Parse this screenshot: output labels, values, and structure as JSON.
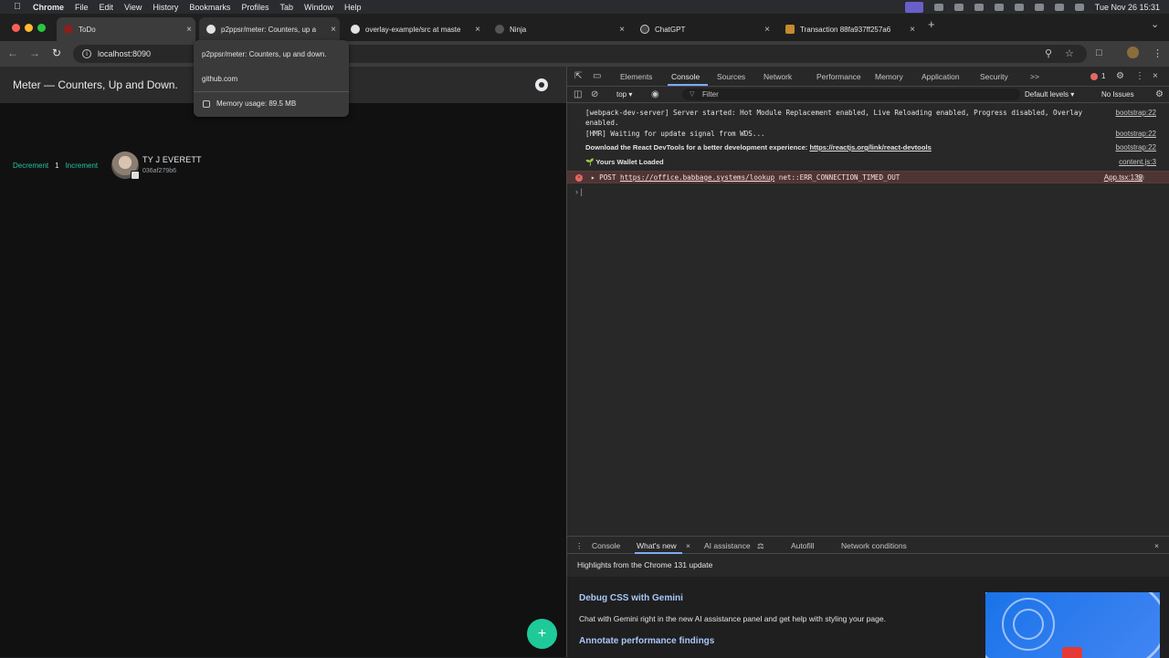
{
  "menubar": {
    "app": "Chrome",
    "menus": [
      "File",
      "Edit",
      "View",
      "History",
      "Bookmarks",
      "Profiles",
      "Tab",
      "Window",
      "Help"
    ],
    "clock": "Tue Nov 26  15:31"
  },
  "tabs": [
    {
      "label": "ToDo",
      "icon": "todo-favicon"
    },
    {
      "label": "p2ppsr/meter: Counters, up a",
      "icon": "github-icon"
    },
    {
      "label": "overlay-example/src at maste",
      "icon": "github-icon"
    },
    {
      "label": "Ninja",
      "icon": "ninja-favicon"
    },
    {
      "label": "ChatGPT",
      "icon": "chatgpt-icon"
    },
    {
      "label": "Transaction 88fa937ff257a6",
      "icon": "transaction-favicon"
    }
  ],
  "tooltip": {
    "title": "p2ppsr/meter: Counters, up and down.",
    "host": "github.com",
    "memory": "Memory usage: 89.5 MB"
  },
  "omnibox": {
    "url": "localhost:8090"
  },
  "app": {
    "title": "Meter — Counters, Up and Down.",
    "decrement": "Decrement",
    "count": "1",
    "increment": "Increment",
    "user_name": "TY J EVERETT",
    "user_id": "036af279b6",
    "fab": "+"
  },
  "devtools": {
    "tabs": [
      "Elements",
      "Console",
      "Sources",
      "Network",
      "Performance",
      "Memory",
      "Application",
      "Security"
    ],
    "more": ">>",
    "error_count": "1",
    "context": "top ▾",
    "filter_placeholder": "Filter",
    "levels": "Default levels ▾",
    "issues": "No Issues",
    "logs": [
      {
        "text": "[webpack-dev-server] Server started: Hot Module Replacement enabled, Live Reloading enabled, Progress disabled, Overlay enabled.",
        "src": "bootstrap:22"
      },
      {
        "text": "[HMR] Waiting for update signal from WDS...",
        "src": "bootstrap:22"
      },
      {
        "text_bold": "Download the React DevTools for a better development experience: ",
        "link": "https://reactjs.org/link/react-devtools",
        "src": "bootstrap:22"
      },
      {
        "text": "🌱 Yours Wallet Loaded",
        "src": "content.js:3"
      }
    ],
    "error": {
      "method": "▸ POST ",
      "url": "https://office.babbage.systems/lookup",
      "message": " net::ERR_CONNECTION_TIMED_OUT",
      "src": "App.tsx:139"
    },
    "prompt": "› |",
    "drawer": {
      "tabs": [
        "Console",
        "What's new",
        "AI assistance",
        "Autofill",
        "Network conditions"
      ],
      "headline": "Highlights from the Chrome 131 update",
      "h1": "Debug CSS with Gemini",
      "p1": "Chat with Gemini right in the new AI assistance panel and get help with styling your page.",
      "h2": "Annotate performance findings"
    }
  }
}
